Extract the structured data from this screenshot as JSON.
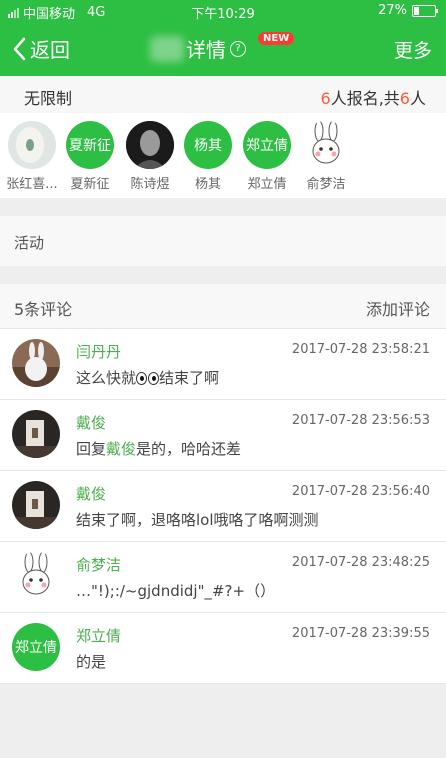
{
  "status": {
    "carrier": "中国移动",
    "network": "4G",
    "time": "下午10:29",
    "battery": "27%",
    "battery_level": 0.27
  },
  "nav": {
    "back": "返回",
    "title": "详情",
    "help": "?",
    "badge": "NEW",
    "more": "更多"
  },
  "limit": {
    "label": "无限制",
    "signed": "6",
    "signed_suffix": "人报名,共",
    "total": "6",
    "total_suffix": "人"
  },
  "members": [
    {
      "name": "张红喜...",
      "avatar_text": ""
    },
    {
      "name": "夏新征",
      "avatar_text": "夏新征"
    },
    {
      "name": "陈诗煜",
      "avatar_text": ""
    },
    {
      "name": "杨其",
      "avatar_text": "杨其"
    },
    {
      "name": "郑立倩",
      "avatar_text": "郑立倩"
    },
    {
      "name": "俞梦洁",
      "avatar_text": ""
    }
  ],
  "activity": {
    "label": "活动"
  },
  "comments_header": {
    "count_label": "5条评论",
    "add_label": "添加评论"
  },
  "comments": [
    {
      "name": "闫丹丹",
      "time": "2017-07-28 23:58:21",
      "text_before": "这么快就",
      "text_after": "结束了啊"
    },
    {
      "name": "戴俊",
      "time": "2017-07-28 23:56:53",
      "reply_prefix": "回复",
      "reply_to": "戴俊",
      "text": "是的，哈哈还差"
    },
    {
      "name": "戴俊",
      "time": "2017-07-28 23:56:40",
      "text": "结束了啊，退咯咯lol哦咯了咯啊测测"
    },
    {
      "name": "俞梦洁",
      "time": "2017-07-28 23:48:25",
      "text": "…\"!);:/~gjdndidj\"_#?+（）"
    },
    {
      "name": "郑立倩",
      "avatar_text": "郑立倩",
      "time": "2017-07-28 23:39:55",
      "text": "的是"
    }
  ],
  "colors": {
    "brand": "#2dbf43",
    "accent_red": "#ff5a3c",
    "name_green": "#4caf50"
  }
}
